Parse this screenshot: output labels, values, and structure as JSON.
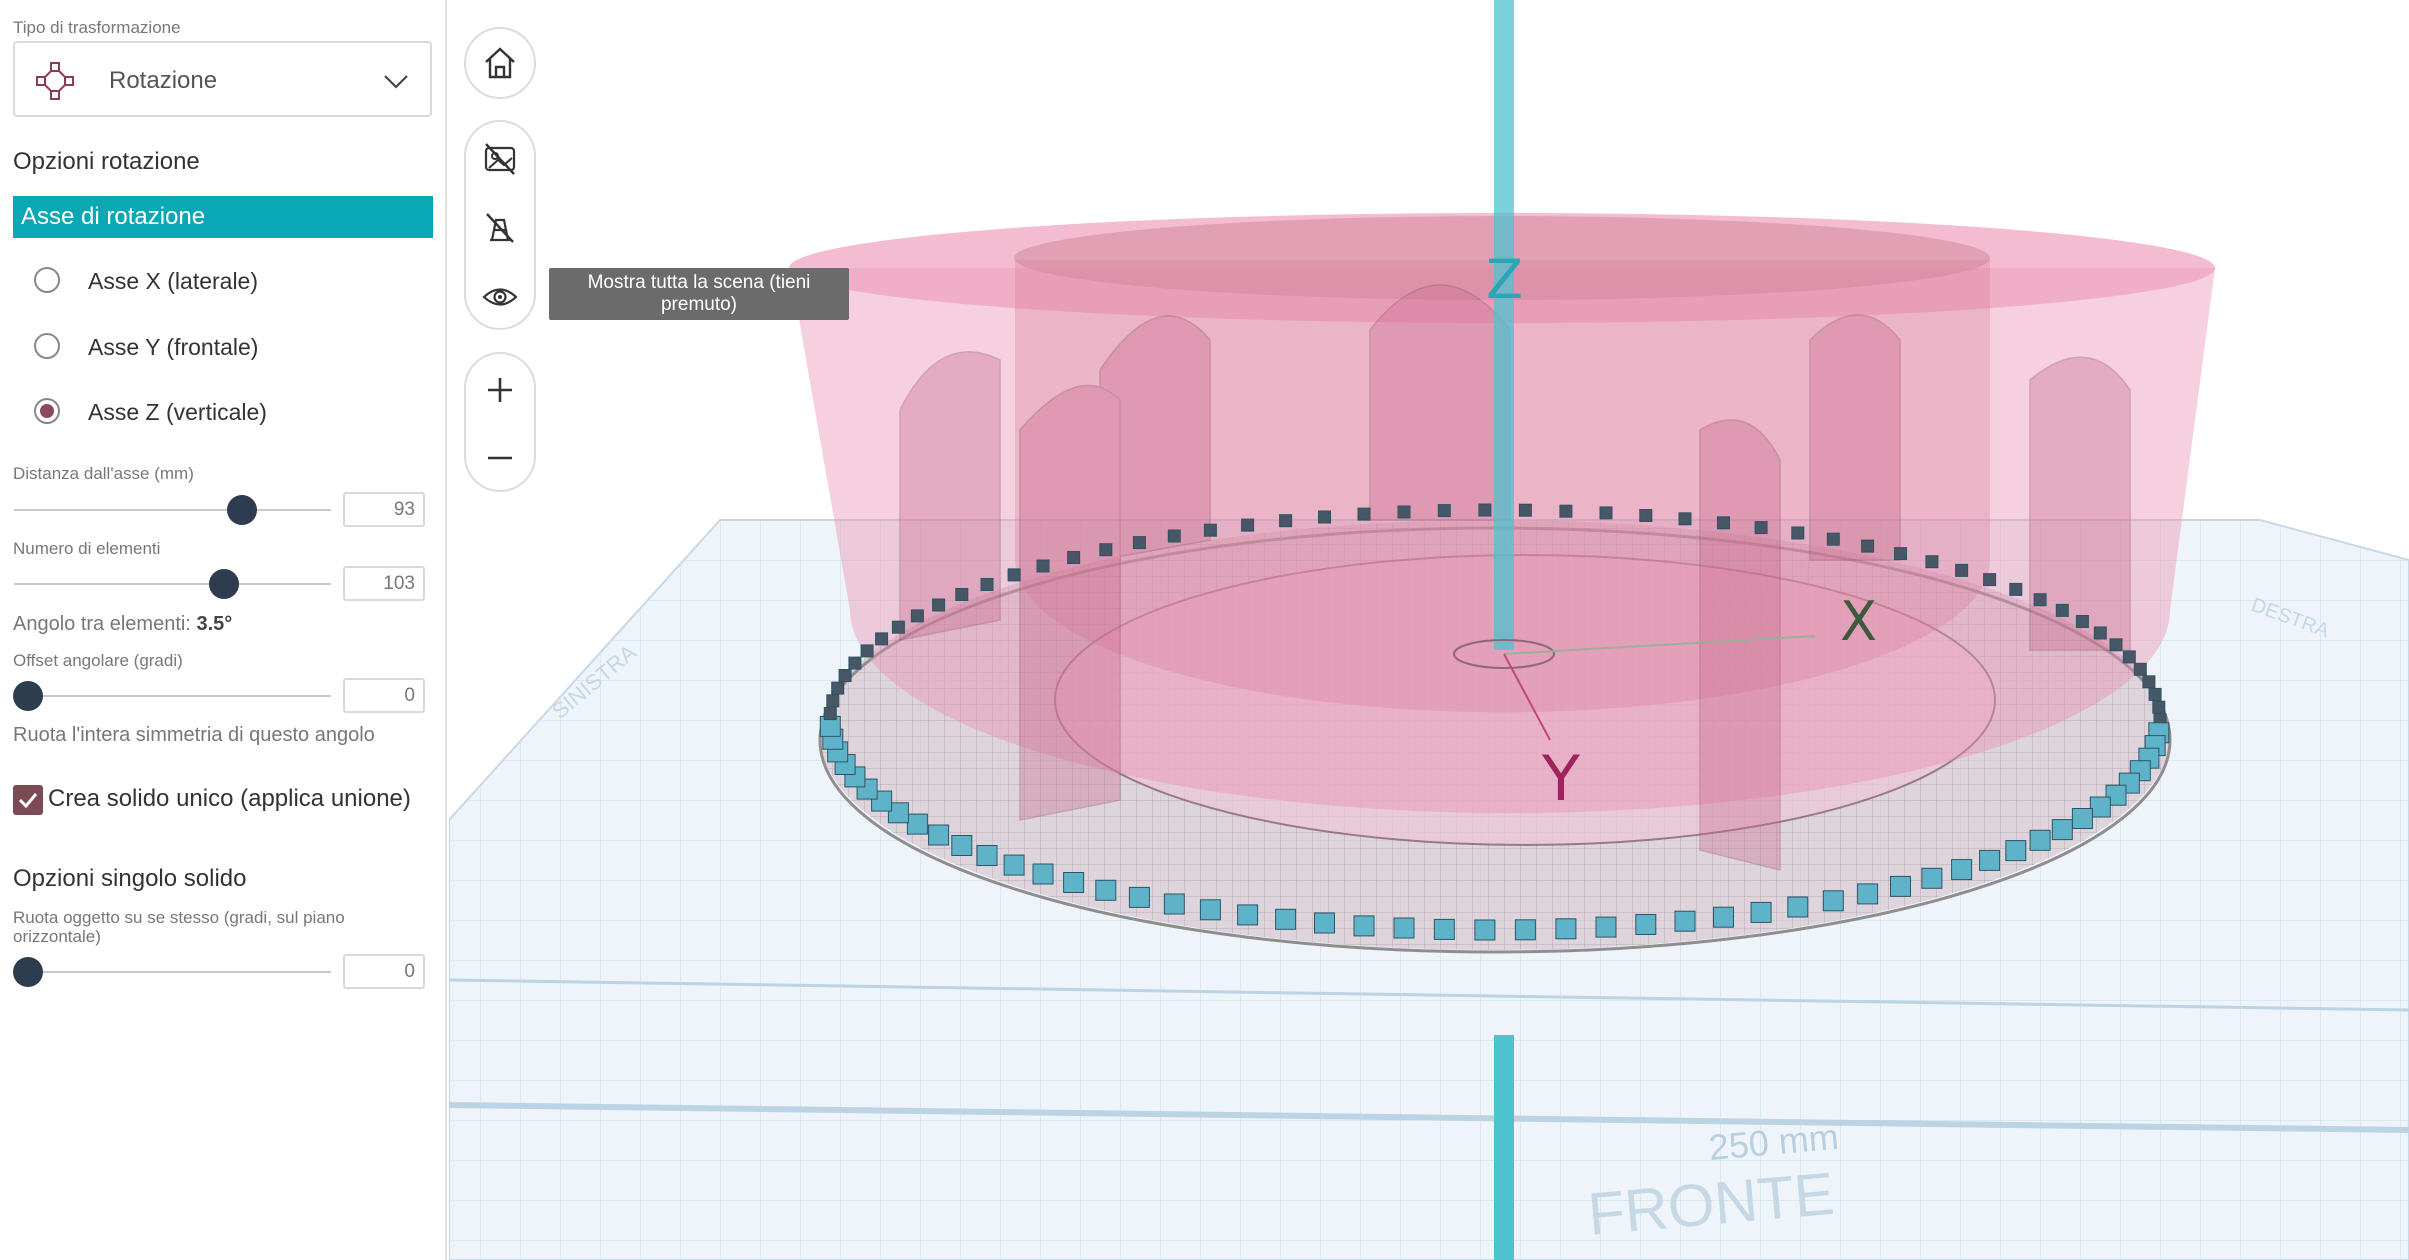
{
  "panel": {
    "transform_type_label": "Tipo di trasformazione",
    "transform_select_value": "Rotazione",
    "rotation_options_title": "Opzioni rotazione",
    "axis_bar_label": "Asse di rotazione",
    "axes": [
      {
        "label": "Asse X (laterale)",
        "checked": false
      },
      {
        "label": "Asse Y (frontale)",
        "checked": false
      },
      {
        "label": "Asse Z (verticale)",
        "checked": true
      }
    ],
    "distance_label": "Distanza dall'asse (mm)",
    "distance_value": "93",
    "count_label": "Numero di elementi",
    "count_value": "103",
    "angle_label": "Angolo tra elementi:",
    "angle_value": "3.5°",
    "offset_label": "Offset angolare (gradi)",
    "offset_value": "0",
    "offset_hint": "Ruota l'intera simmetria di questo angolo",
    "union_label": "Crea solido unico (applica unione)",
    "union_checked": true,
    "single_title": "Opzioni singolo solido",
    "single_rotate_label_1": "Ruota oggetto su se stesso (gradi, sul piano",
    "single_rotate_label_2": "orizzontale)",
    "single_rotate_value": "0"
  },
  "viewport": {
    "tooltip": "Mostra tutta la scena (tieni premuto)",
    "axis_z": "Z",
    "axis_x": "X",
    "axis_y": "Y",
    "front_label": "FRONTE",
    "dimension_label": "250 mm",
    "left_label": "SINISTRA",
    "right_label": "DESTRA"
  },
  "colors": {
    "accent": "#0aa8b4",
    "pink": "#e98fb0",
    "thumb": "#2d3c4e",
    "checkbox": "#7b4a55",
    "axis_cyan": "#4fc2cf"
  }
}
